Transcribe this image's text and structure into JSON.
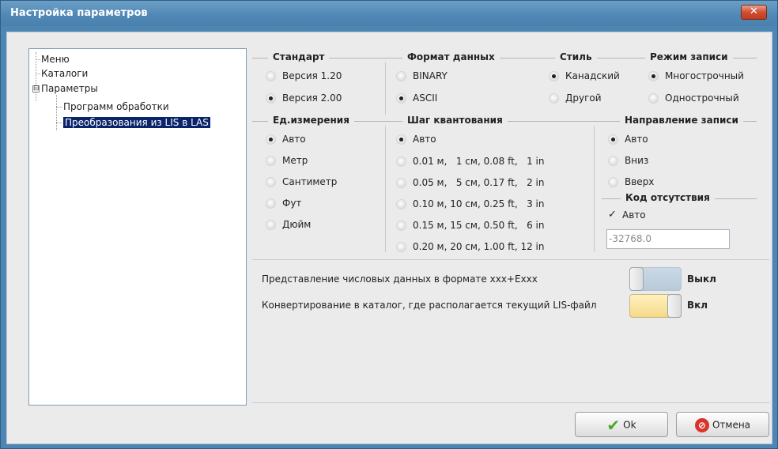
{
  "window": {
    "title": "Настройка параметров",
    "close_glyph": "✕"
  },
  "tree": {
    "items": [
      {
        "label": "Меню"
      },
      {
        "label": "Каталоги"
      },
      {
        "label": "Параметры",
        "expander": "⊟"
      },
      {
        "label": "Программ обработки"
      },
      {
        "label": "Преобразования из LIS в LAS",
        "selected": true
      }
    ]
  },
  "groups": {
    "standard": {
      "title": "Стандарт",
      "options": [
        {
          "label": "Версия 1.20",
          "selected": false
        },
        {
          "label": "Версия 2.00",
          "selected": true
        }
      ]
    },
    "data_format": {
      "title": "Формат данных",
      "options": [
        {
          "label": "BINARY",
          "selected": false
        },
        {
          "label": "ASCII",
          "selected": true
        }
      ]
    },
    "style": {
      "title": "Стиль",
      "options": [
        {
          "label": "Канадский",
          "selected": true
        },
        {
          "label": "Другой",
          "selected": false
        }
      ]
    },
    "write_mode": {
      "title": "Режим записи",
      "options": [
        {
          "label": "Многострочный",
          "selected": true
        },
        {
          "label": "Однострочный",
          "selected": false
        }
      ]
    },
    "units": {
      "title": "Ед.измерения",
      "options": [
        {
          "label": "Авто",
          "selected": true
        },
        {
          "label": "Метр",
          "selected": false
        },
        {
          "label": "Сантиметр",
          "selected": false
        },
        {
          "label": "Фут",
          "selected": false
        },
        {
          "label": "Дюйм",
          "selected": false
        }
      ]
    },
    "quant_step": {
      "title": "Шаг квантования",
      "options": [
        {
          "label": "Авто",
          "selected": true
        },
        {
          "label": "0.01 м,   1 см, 0.08 ft,   1 in",
          "selected": false
        },
        {
          "label": "0.05 м,   5 см, 0.17 ft,   2 in",
          "selected": false
        },
        {
          "label": "0.10 м, 10 см, 0.25 ft,   3 in",
          "selected": false
        },
        {
          "label": "0.15 м, 15 см, 0.50 ft,   6 in",
          "selected": false
        },
        {
          "label": "0.20 м, 20 см, 1.00 ft, 12 in",
          "selected": false
        }
      ]
    },
    "direction": {
      "title": "Направление записи",
      "options": [
        {
          "label": "Авто",
          "selected": true
        },
        {
          "label": "Вниз",
          "selected": false
        },
        {
          "label": "Вверх",
          "selected": false
        }
      ]
    },
    "missing_code": {
      "title": "Код отсутствия",
      "auto_label": "Авто",
      "auto_checked": true,
      "check_glyph": "✓",
      "value": "-32768.0"
    }
  },
  "settings": {
    "exp_format": {
      "label": "Представление числовых данных в формате xxx+Exxx",
      "state": "Выкл",
      "on": false
    },
    "convert_dir": {
      "label": "Конвертирование в каталог, где располагается текущий LIS-файл",
      "state": "Вкл",
      "on": true
    }
  },
  "buttons": {
    "ok": {
      "label": "Ok",
      "icon": "✔"
    },
    "cancel": {
      "label": "Отмена",
      "icon": "⊘"
    }
  },
  "colors": {
    "titlebar": "#5189b6",
    "client_bg": "#ecebeb",
    "selection": "#0a246a",
    "toggle_off": "#c3d3e2",
    "toggle_on": "#f5d98a"
  }
}
